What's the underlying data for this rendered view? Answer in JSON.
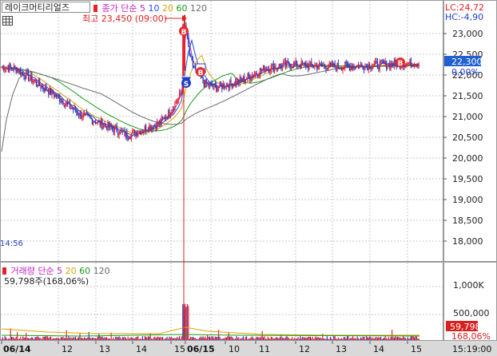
{
  "header": {
    "stock_name": "레이크머티리얼즈",
    "price_label": "종가",
    "ma_label": "단순",
    "ma_periods": [
      "5",
      "10",
      "20",
      "60",
      "120"
    ],
    "lc_label": "LC:24,72",
    "hc_label": "HC:-4,90",
    "high_annotation": "최고 23,450 (09:00)"
  },
  "price_axis": {
    "ticks": [
      "23,000",
      "22,500",
      "22,000",
      "21,500",
      "21,000",
      "20,500",
      "20,000",
      "19,500",
      "19,000",
      "18,500",
      "18,000"
    ],
    "current_price": "22,300",
    "current_change": "0,00%"
  },
  "left_time_label": "14:56",
  "volume": {
    "label": "거래량",
    "ma_label": "단순",
    "ma_periods": [
      "5",
      "20",
      "60",
      "120"
    ],
    "value_text": "59,798주(168,06%)",
    "ticks": [
      "1,000K",
      "500,000"
    ],
    "current_volume": "59,798",
    "current_pct": "168,06%"
  },
  "x_axis": {
    "labels": [
      "06/14",
      "12",
      "13",
      "14",
      "15",
      "06/15",
      "10",
      "11",
      "12",
      "13",
      "14",
      "15"
    ],
    "time": "15:19:00"
  },
  "markers": [
    "B",
    "S",
    "B",
    "B"
  ],
  "colors": {
    "up": "#e8202a",
    "down": "#1d3fc8",
    "ma5": "#c020c0",
    "ma10": "#1f4fd0",
    "ma20": "#d8a400",
    "ma60": "#1a9a1a",
    "ma120": "#6a6a6a",
    "current_price_bg": "#2060d0",
    "current_volume_bg": "#d82020"
  },
  "chart_data": {
    "type": "candlestick",
    "price_range": [
      17500,
      23500
    ],
    "high": 23450,
    "sessions": [
      {
        "date": "06/14",
        "points": [
          {
            "t": "11",
            "p": 22200
          },
          {
            "t": "11",
            "p": 22150
          },
          {
            "t": "12",
            "p": 21500
          },
          {
            "t": "12",
            "p": 21050
          },
          {
            "t": "13",
            "p": 20800
          },
          {
            "t": "13",
            "p": 20550
          },
          {
            "t": "14",
            "p": 20700
          },
          {
            "t": "14",
            "p": 20850
          },
          {
            "t": "15",
            "p": 21150
          },
          {
            "t": "15",
            "p": 21600
          }
        ]
      },
      {
        "date": "06/15",
        "points": [
          {
            "t": "09",
            "p": 23450
          },
          {
            "t": "09",
            "p": 22350
          },
          {
            "t": "10",
            "p": 21800
          },
          {
            "t": "10",
            "p": 21700
          },
          {
            "t": "11",
            "p": 21850
          },
          {
            "t": "11",
            "p": 22150
          },
          {
            "t": "12",
            "p": 22250
          },
          {
            "t": "13",
            "p": 22200
          },
          {
            "t": "14",
            "p": 22250
          },
          {
            "t": "15",
            "p": 22300
          }
        ]
      }
    ],
    "volume_max": "1,000K"
  }
}
